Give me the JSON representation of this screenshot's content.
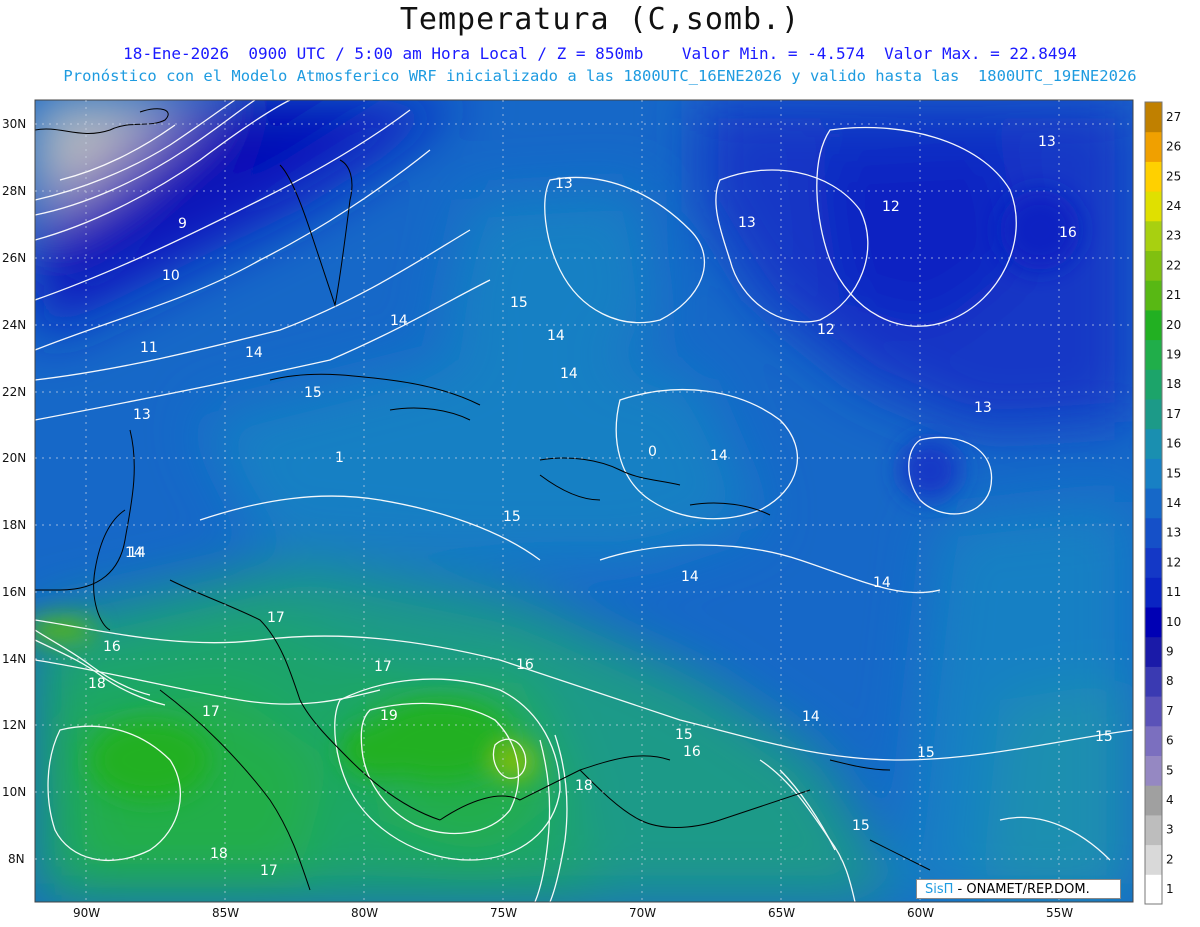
{
  "header": {
    "title": "Temperatura (C,somb.)",
    "line1": "18-Ene-2026  0900 UTC / 5:00 am Hora Local / Z = 850mb    Valor Min. = -4.574  Valor Max. = 22.8494",
    "line2": "Pronóstico con el Modelo Atmosferico WRF inicializado a las 1800UTC_16ENE2026 y valido hasta las  1800UTC_19ENE2026"
  },
  "axes": {
    "lat_labels": [
      "30N",
      "28N",
      "26N",
      "24N",
      "22N",
      "20N",
      "18N",
      "16N",
      "14N",
      "12N",
      "10N",
      "8N"
    ],
    "lon_labels": [
      "90W",
      "85W",
      "80W",
      "75W",
      "70W",
      "65W",
      "60W",
      "55W"
    ]
  },
  "colorbar": {
    "levels": [
      "1",
      "2",
      "3",
      "4",
      "5",
      "6",
      "7",
      "8",
      "9",
      "10",
      "11",
      "12",
      "13",
      "14",
      "15",
      "16",
      "17",
      "18",
      "19",
      "20",
      "21",
      "22",
      "23",
      "24",
      "25",
      "26",
      "27"
    ],
    "colors": [
      "#ffffff",
      "#d9d9d9",
      "#bdbdbd",
      "#a0a0a0",
      "#9588c2",
      "#7b6fbf",
      "#5a52b8",
      "#3a3ab2",
      "#1a1aa8",
      "#0000b4",
      "#0a24c2",
      "#1438c6",
      "#1550c8",
      "#1668c8",
      "#1880c4",
      "#1a8fb0",
      "#1c9a88",
      "#1ca46a",
      "#20ae4a",
      "#22b022",
      "#58b814",
      "#80c010",
      "#a8d010",
      "#e0e000",
      "#ffd000",
      "#f0a000",
      "#c08000"
    ]
  },
  "contour_labels": [
    "9",
    "10",
    "11",
    "13",
    "13",
    "12",
    "13",
    "12",
    "13",
    "14",
    "15",
    "14",
    "14",
    "15",
    "14",
    "13",
    "14",
    "15",
    "16",
    "14",
    "14",
    "14",
    "16",
    "17",
    "17",
    "18",
    "17",
    "19",
    "15",
    "16",
    "14",
    "15",
    "15",
    "15",
    "18",
    "16",
    "17",
    "18",
    "14",
    "0",
    "1"
  ],
  "credit": {
    "brand": "SisΠ",
    "text": " - ONAMET/REP.DOM."
  }
}
